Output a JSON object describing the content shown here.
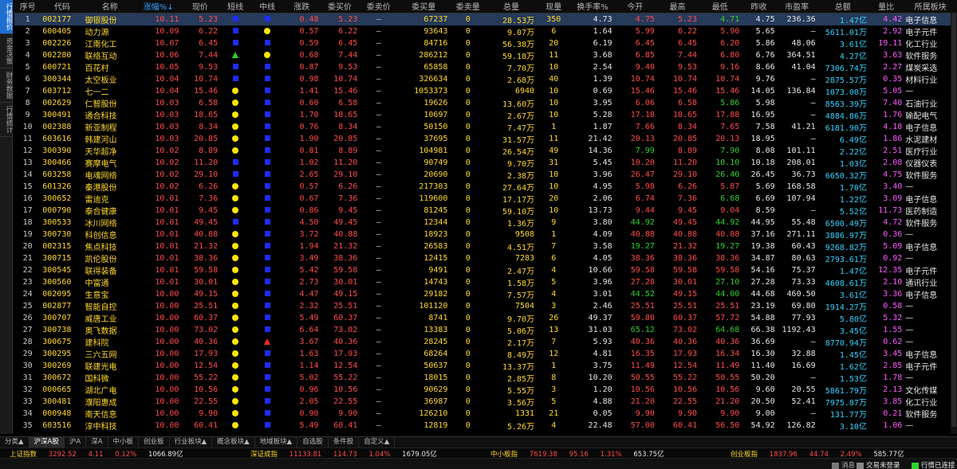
{
  "sidebar": {
    "tabs": [
      "行情报价",
      "资金决策",
      "财务数据",
      "行情统计"
    ]
  },
  "columns": [
    "序号",
    "代码",
    "名称",
    "涨幅%↓",
    "现价",
    "短线",
    "中线",
    "涨跌",
    "委买价",
    "委卖价",
    "委买量",
    "委卖量",
    "总量",
    "现量",
    "换手率%",
    "今开",
    "最高",
    "最低",
    "昨收",
    "市盈率",
    "总额",
    "量比",
    "所属板块"
  ],
  "rows": [
    [
      "1",
      "002177",
      "御银股份",
      "10.11",
      "5.23",
      "sq",
      "sq",
      "0.48",
      "5.23",
      "—",
      "67237",
      "0",
      "28.53万",
      "350",
      "4.73",
      "4.75",
      "5.23",
      "4.71",
      "4.75",
      "236.36",
      "1.47亿",
      "4.42",
      "电子信息"
    ],
    [
      "2",
      "600405",
      "动力源",
      "10.09",
      "6.22",
      "sq",
      "circ",
      "0.57",
      "6.22",
      "—",
      "93643",
      "0",
      "9.07万",
      "6",
      "1.64",
      "5.99",
      "6.22",
      "5.90",
      "5.65",
      "—",
      "5611.01万",
      "2.92",
      "电子元件"
    ],
    [
      "3",
      "002226",
      "江南化工",
      "10.07",
      "6.45",
      "sq",
      "sq",
      "0.59",
      "6.45",
      "—",
      "84716",
      "0",
      "56.38万",
      "20",
      "6.19",
      "6.45",
      "6.45",
      "6.20",
      "5.86",
      "48.06",
      "3.61亿",
      "19.11",
      "化工行业"
    ],
    [
      "4",
      "002280",
      "联络互动",
      "10.06",
      "7.44",
      "tri",
      "circ",
      "0.68",
      "7.44",
      "—",
      "286212",
      "0",
      "59.18万",
      "11",
      "3.68",
      "6.85",
      "7.44",
      "6.80",
      "6.76",
      "364.51",
      "4.27亿",
      "3.63",
      "软件服务"
    ],
    [
      "5",
      "600721",
      "百花村",
      "10.05",
      "9.53",
      "sq",
      "sq",
      "0.87",
      "9.53",
      "—",
      "65858",
      "0",
      "7.70万",
      "10",
      "2.54",
      "9.40",
      "9.53",
      "9.16",
      "8.66",
      "41.04",
      "7306.74万",
      "2.27",
      "煤炭采选"
    ],
    [
      "6",
      "300344",
      "太空板业",
      "10.04",
      "10.74",
      "sq",
      "sq",
      "0.98",
      "10.74",
      "—",
      "326634",
      "0",
      "2.68万",
      "40",
      "1.39",
      "10.74",
      "10.74",
      "10.74",
      "9.76",
      "—",
      "2875.57万",
      "0.35",
      "材料行业"
    ],
    [
      "7",
      "603712",
      "七一二",
      "10.04",
      "15.46",
      "circ",
      "sq",
      "1.41",
      "15.46",
      "—",
      "1053373",
      "0",
      "6940",
      "10",
      "0.69",
      "15.46",
      "15.46",
      "15.46",
      "14.05",
      "136.84",
      "1073.00万",
      "5.05",
      "—"
    ],
    [
      "8",
      "002629",
      "仁智股份",
      "10.03",
      "6.58",
      "circ",
      "sq",
      "0.60",
      "6.58",
      "—",
      "19626",
      "0",
      "13.60万",
      "10",
      "3.95",
      "6.06",
      "6.58",
      "5.86",
      "5.98",
      "—",
      "8563.39万",
      "7.40",
      "石油行业"
    ],
    [
      "9",
      "300491",
      "通合科技",
      "10.03",
      "18.65",
      "circ",
      "sq",
      "1.70",
      "18.65",
      "—",
      "10697",
      "0",
      "2.67万",
      "10",
      "5.28",
      "17.18",
      "18.65",
      "17.88",
      "16.95",
      "—",
      "4884.86万",
      "1.76",
      "输配电气"
    ],
    [
      "10",
      "002388",
      "新亚制程",
      "10.03",
      "8.34",
      "circ",
      "sq",
      "0.76",
      "8.34",
      "—",
      "50150",
      "0",
      "7.47万",
      "1",
      "1.87",
      "7.66",
      "8.34",
      "7.65",
      "7.58",
      "41.21",
      "6181.90万",
      "4.18",
      "电子信息"
    ],
    [
      "11",
      "603616",
      "韩建河山",
      "10.03",
      "20.85",
      "circ",
      "sq",
      "1.90",
      "20.85",
      "—",
      "37695",
      "0",
      "31.57万",
      "11",
      "21.42",
      "20.13",
      "20.85",
      "20.13",
      "18.95",
      "—",
      "6.49亿",
      "1.86",
      "水泥建材"
    ],
    [
      "12",
      "300390",
      "天华超净",
      "10.02",
      "8.89",
      "circ",
      "sq",
      "0.81",
      "8.89",
      "—",
      "104981",
      "0",
      "26.54万",
      "49",
      "14.36",
      "7.99",
      "8.89",
      "7.90",
      "8.08",
      "101.11",
      "2.22亿",
      "2.51",
      "医疗行业"
    ],
    [
      "13",
      "300466",
      "赛摩电气",
      "10.02",
      "11.20",
      "sq",
      "sq",
      "1.02",
      "11.20",
      "—",
      "90749",
      "0",
      "9.70万",
      "31",
      "5.45",
      "10.20",
      "11.20",
      "10.10",
      "10.18",
      "208.01",
      "1.03亿",
      "2.08",
      "仪器仪表"
    ],
    [
      "14",
      "603258",
      "电魂网络",
      "10.02",
      "29.10",
      "sq",
      "sq",
      "2.65",
      "29.10",
      "—",
      "20690",
      "0",
      "2.38万",
      "10",
      "3.96",
      "26.47",
      "29.10",
      "26.40",
      "26.45",
      "36.73",
      "6650.32万",
      "4.75",
      "软件服务"
    ],
    [
      "15",
      "601326",
      "秦港股份",
      "10.02",
      "6.26",
      "circ",
      "sq",
      "0.57",
      "6.26",
      "—",
      "217303",
      "0",
      "27.64万",
      "10",
      "4.95",
      "5.98",
      "6.26",
      "5.87",
      "5.69",
      "168.58",
      "1.70亿",
      "3.40",
      "—"
    ],
    [
      "16",
      "300652",
      "雷迪克",
      "10.01",
      "7.36",
      "circ",
      "sq",
      "0.67",
      "7.36",
      "—",
      "119600",
      "0",
      "17.17万",
      "20",
      "2.06",
      "6.74",
      "7.36",
      "6.68",
      "6.69",
      "107.94",
      "1.22亿",
      "3.09",
      "电子信息"
    ],
    [
      "17",
      "000790",
      "泰合健康",
      "10.01",
      "9.45",
      "circ",
      "sq",
      "0.86",
      "9.45",
      "—",
      "81245",
      "0",
      "59.10万",
      "10",
      "13.73",
      "9.44",
      "9.45",
      "9.04",
      "8.59",
      "—",
      "5.52亿",
      "11.73",
      "医药制造"
    ],
    [
      "18",
      "300533",
      "冰川网络",
      "10.01",
      "49.45",
      "sq",
      "sq",
      "4.50",
      "49.45",
      "—",
      "12344",
      "0",
      "1.36万",
      "9",
      "3.80",
      "44.92",
      "49.45",
      "44.92",
      "44.95",
      "55.48",
      "6500.49万",
      "4.72",
      "软件服务"
    ],
    [
      "19",
      "300730",
      "科创信息",
      "10.01",
      "40.88",
      "circ",
      "sq",
      "3.72",
      "40.88",
      "—",
      "18923",
      "0",
      "9508",
      "1",
      "4.09",
      "40.88",
      "40.88",
      "40.88",
      "37.16",
      "271.11",
      "3886.97万",
      "0.36",
      "—"
    ],
    [
      "20",
      "002315",
      "焦点科技",
      "10.01",
      "21.32",
      "circ",
      "sq",
      "1.94",
      "21.32",
      "—",
      "26583",
      "0",
      "4.51万",
      "7",
      "3.58",
      "19.27",
      "21.32",
      "19.27",
      "19.38",
      "60.43",
      "9268.82万",
      "5.09",
      "电子信息"
    ],
    [
      "21",
      "300715",
      "凯伦股份",
      "10.01",
      "38.36",
      "circ",
      "sq",
      "3.49",
      "38.36",
      "—",
      "12415",
      "0",
      "7283",
      "6",
      "4.05",
      "38.36",
      "38.36",
      "38.36",
      "34.87",
      "80.63",
      "2793.61万",
      "0.92",
      "—"
    ],
    [
      "22",
      "300545",
      "联得装备",
      "10.01",
      "59.58",
      "circ",
      "sq",
      "5.42",
      "59.58",
      "—",
      "9491",
      "0",
      "2.47万",
      "4",
      "10.66",
      "59.58",
      "59.58",
      "59.58",
      "54.16",
      "75.37",
      "1.47亿",
      "12.35",
      "电子元件"
    ],
    [
      "23",
      "300560",
      "中富通",
      "10.01",
      "30.01",
      "circ",
      "sq",
      "2.73",
      "30.01",
      "—",
      "14743",
      "0",
      "1.58万",
      "5",
      "3.96",
      "27.28",
      "30.01",
      "27.10",
      "27.28",
      "73.33",
      "4608.61万",
      "2.10",
      "通讯行业"
    ],
    [
      "24",
      "002095",
      "生意宝",
      "10.00",
      "49.15",
      "circ",
      "sq",
      "4.47",
      "49.15",
      "—",
      "29182",
      "0",
      "7.57万",
      "4",
      "3.01",
      "44.52",
      "49.15",
      "44.00",
      "44.68",
      "460.50",
      "3.61亿",
      "3.36",
      "电子信息"
    ],
    [
      "25",
      "002877",
      "智能自控",
      "10.00",
      "25.51",
      "circ",
      "sq",
      "2.32",
      "25.51",
      "—",
      "101120",
      "0",
      "7504",
      "3",
      "2.46",
      "25.51",
      "25.51",
      "25.51",
      "23.19",
      "69.80",
      "1914.27万",
      "0.58",
      "—"
    ],
    [
      "26",
      "300707",
      "威唐工业",
      "10.00",
      "60.37",
      "circ",
      "sq",
      "5.49",
      "60.37",
      "—",
      "8741",
      "0",
      "9.70万",
      "26",
      "49.37",
      "59.80",
      "60.37",
      "57.72",
      "54.88",
      "77.93",
      "5.80亿",
      "5.32",
      "—"
    ],
    [
      "27",
      "300738",
      "奥飞数据",
      "10.00",
      "73.02",
      "circ",
      "sq",
      "6.64",
      "73.02",
      "—",
      "13383",
      "0",
      "5.06万",
      "13",
      "31.03",
      "65.12",
      "73.02",
      "64.68",
      "66.38",
      "1192.43",
      "3.45亿",
      "1.55",
      "—"
    ],
    [
      "28",
      "300675",
      "建科院",
      "10.00",
      "40.36",
      "circ",
      "trired",
      "3.67",
      "40.36",
      "—",
      "28245",
      "0",
      "2.17万",
      "7",
      "5.93",
      "40.36",
      "40.36",
      "40.36",
      "36.69",
      "—",
      "8770.94万",
      "0.62",
      "—"
    ],
    [
      "29",
      "300295",
      "三六五网",
      "10.00",
      "17.93",
      "circ",
      "sq",
      "1.63",
      "17.93",
      "—",
      "68264",
      "0",
      "8.49万",
      "12",
      "4.81",
      "16.35",
      "17.93",
      "16.34",
      "16.30",
      "32.88",
      "1.45亿",
      "3.45",
      "电子信息"
    ],
    [
      "30",
      "300269",
      "联建光电",
      "10.00",
      "12.54",
      "circ",
      "sq",
      "1.14",
      "12.54",
      "—",
      "50637",
      "0",
      "13.37万",
      "1",
      "3.75",
      "11.49",
      "12.54",
      "11.49",
      "11.40",
      "16.69",
      "1.62亿",
      "2.85",
      "电子元件"
    ],
    [
      "31",
      "300672",
      "国科微",
      "10.00",
      "55.22",
      "circ",
      "sq",
      "5.02",
      "55.22",
      "—",
      "18015",
      "0",
      "2.85万",
      "8",
      "10.20",
      "50.55",
      "55.22",
      "50.55",
      "50.20",
      "—",
      "1.53亿",
      "1.78",
      "—"
    ],
    [
      "32",
      "000665",
      "湖北广电",
      "10.00",
      "10.56",
      "circ",
      "sq",
      "0.96",
      "10.56",
      "—",
      "90629",
      "0",
      "5.55万",
      "3",
      "1.20",
      "10.56",
      "10.56",
      "10.56",
      "9.60",
      "20.55",
      "5861.79万",
      "2.13",
      "文化传媒"
    ],
    [
      "33",
      "300481",
      "濮阳惠成",
      "10.00",
      "22.55",
      "circ",
      "sq",
      "2.05",
      "22.55",
      "—",
      "36987",
      "0",
      "3.56万",
      "5",
      "4.88",
      "21.20",
      "22.55",
      "21.20",
      "20.50",
      "52.41",
      "7975.87万",
      "3.85",
      "化工行业"
    ],
    [
      "34",
      "000948",
      "南天信息",
      "10.00",
      "9.90",
      "circ",
      "sq",
      "0.90",
      "9.90",
      "—",
      "126210",
      "0",
      "1331",
      "21",
      "0.05",
      "9.90",
      "9.90",
      "9.90",
      "9.00",
      "—",
      "131.77万",
      "0.21",
      "软件服务"
    ],
    [
      "35",
      "603516",
      "淳中科技",
      "10.00",
      "60.41",
      "circ",
      "sq",
      "5.49",
      "60.41",
      "—",
      "12819",
      "0",
      "5.26万",
      "4",
      "22.48",
      "57.00",
      "60.41",
      "56.50",
      "54.92",
      "126.82",
      "3.10亿",
      "1.06",
      "—"
    ]
  ],
  "bottom_tabs": [
    "分类▲",
    "沪深A股",
    "沪A",
    "深A",
    "中小板",
    "创业板",
    "行业板块▲",
    "概念板块▲",
    "地域板块▲",
    "自选股",
    "条件股",
    "自定义▲"
  ],
  "indices": [
    {
      "name": "上证指数",
      "value": "3292.52",
      "chg": "4.11",
      "pct": "0.12%",
      "amt": "1066.89亿"
    },
    {
      "name": "深证成指",
      "value": "11133.81",
      "chg": "114.73",
      "pct": "1.04%",
      "amt": "1679.05亿"
    },
    {
      "name": "中小板指",
      "value": "7619.38",
      "chg": "95.16",
      "pct": "1.31%",
      "amt": "653.75亿"
    },
    {
      "name": "创业板指",
      "value": "1837.96",
      "chg": "44.74",
      "pct": "2.49%",
      "amt": "585.77亿"
    }
  ],
  "status": {
    "msg": "消息",
    "login": "交易未登录",
    "conn": "行情已连接"
  },
  "colors": {
    "up": "#ff4c4c",
    "down": "#2fd12f",
    "name": "#ffd92a",
    "selected": "#263a5a",
    "amount": "#35d3ff",
    "volratio": "#ff5cff"
  }
}
